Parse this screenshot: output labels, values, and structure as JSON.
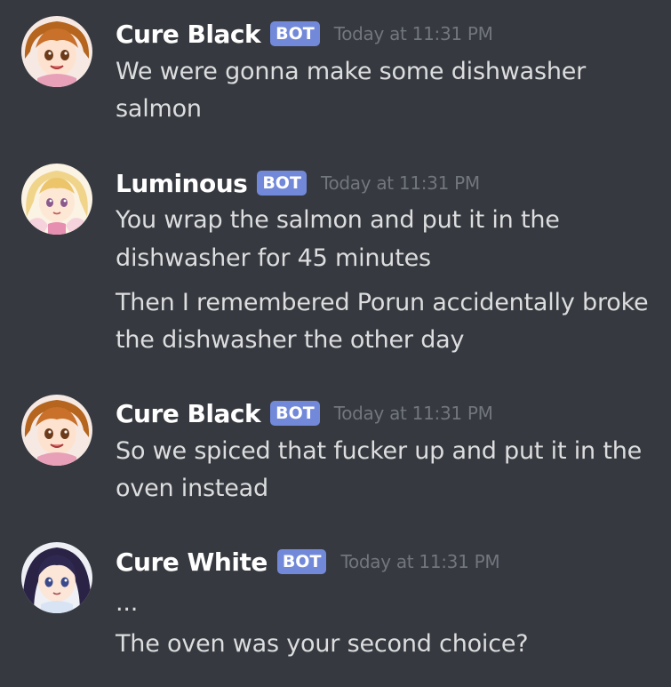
{
  "messages": [
    {
      "username": "Cure Black",
      "badge": "BOT",
      "timestamp": "Today at 11:31 PM",
      "avatar_icon": "cure-black-avatar-icon",
      "lines": [
        "We were gonna make some dishwasher",
        "salmon"
      ]
    },
    {
      "username": "Luminous",
      "badge": "BOT",
      "timestamp": "Today at 11:31 PM",
      "avatar_icon": "luminous-avatar-icon",
      "lines": [
        "You wrap the salmon and put it in the",
        "dishwasher for 45 minutes",
        "Then I remembered Porun accidentally broke",
        "the dishwasher the other day"
      ]
    },
    {
      "username": "Cure Black",
      "badge": "BOT",
      "timestamp": "Today at 11:31 PM",
      "avatar_icon": "cure-black-avatar-icon",
      "lines": [
        "So we spiced that fucker up and put it in the",
        "oven instead"
      ]
    },
    {
      "username": "Cure White",
      "badge": "BOT",
      "timestamp": "Today at 11:31 PM",
      "avatar_icon": "cure-white-avatar-icon",
      "lines": [
        "...",
        "The oven was your second choice?"
      ]
    }
  ],
  "colors": {
    "background": "#36393f",
    "username": "#ffffff",
    "badge": "#7289da",
    "timestamp": "#72767d",
    "message_text": "#dcddde"
  }
}
